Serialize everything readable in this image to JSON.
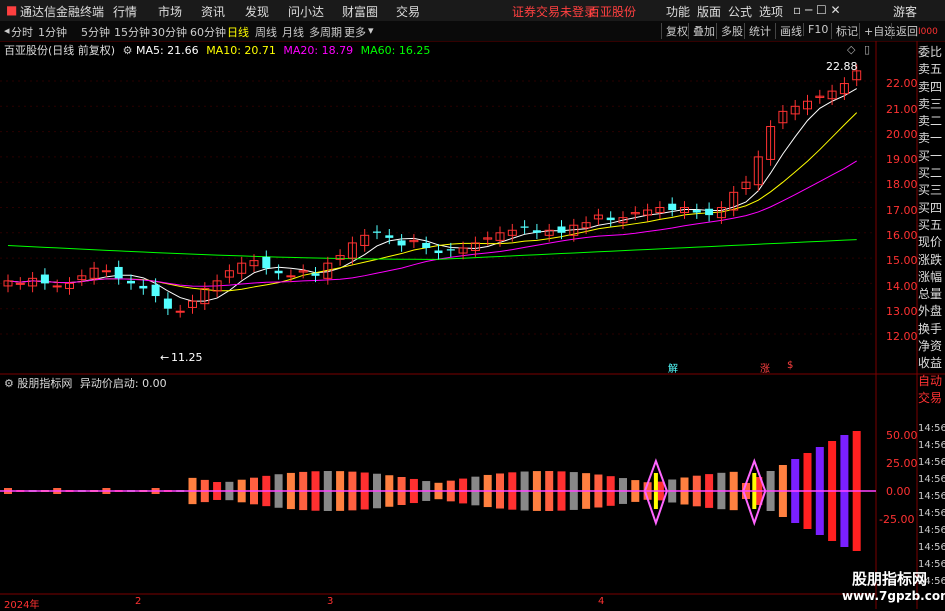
{
  "app": {
    "title": "通达信金融终端",
    "menu": [
      "行情",
      "市场",
      "资讯",
      "发现",
      "问小达",
      "财富圈",
      "交易"
    ],
    "notice": "证券交易未登录",
    "stock_tab": "百亚股份",
    "right_menu": [
      "功能",
      "版面",
      "公式",
      "选项"
    ],
    "user": "游客"
  },
  "toolbar": {
    "periods": [
      "分时",
      "1分钟",
      "5分钟",
      "15分钟",
      "30分钟",
      "60分钟",
      "日线",
      "周线",
      "月线",
      "多周期",
      "更多"
    ],
    "selected": "日线",
    "right": [
      "复权",
      "叠加",
      "多股",
      "统计",
      "画线",
      "F10",
      "标记",
      "+自选",
      "返回"
    ]
  },
  "main_chart": {
    "title": "百亚股份(日线 前复权)",
    "ma5": "MA5: 21.66",
    "ma10": "MA10: 20.71",
    "ma20": "MA20: 18.79",
    "ma60": "MA60: 16.25",
    "high_label": "22.88",
    "low_label": "11.25",
    "ylabels": [
      "22.00",
      "21.00",
      "20.00",
      "19.00",
      "18.00",
      "17.00",
      "16.00",
      "15.00",
      "14.00",
      "13.00",
      "12.00"
    ],
    "marker_jie": "解",
    "marker_zhang": "涨",
    "marker_s": "$",
    "colors": {
      "up": "#ff3232",
      "down": "#54ffff",
      "ma5": "#ffffff",
      "ma10": "#ffff00",
      "ma20": "#ff00ff",
      "ma60": "#00ff00"
    }
  },
  "sub_chart": {
    "title": "股朋指标网",
    "indicator": "异动价启动: 0.00",
    "ylabels": [
      "50.00",
      "25.00",
      "0.00",
      "-25.00"
    ]
  },
  "xaxis": [
    "2024年",
    "2",
    "3",
    "4"
  ],
  "sidebar": {
    "items": [
      "委比",
      "卖五",
      "卖四",
      "卖三",
      "卖二",
      "卖一",
      "买一",
      "买二",
      "买三",
      "买四",
      "买五",
      "现价",
      "涨跌",
      "涨幅",
      "总量",
      "外盘",
      "换手",
      "净资",
      "收益",
      "自动",
      "交易"
    ],
    "times": [
      "14:56",
      "14:56",
      "14:56",
      "14:56",
      "14:56",
      "14:56",
      "14:56",
      "14:56",
      "14:56",
      "14:56"
    ]
  },
  "watermark": {
    "line1": "股朋指标网",
    "line2": "www.7gpzb.com"
  }
}
